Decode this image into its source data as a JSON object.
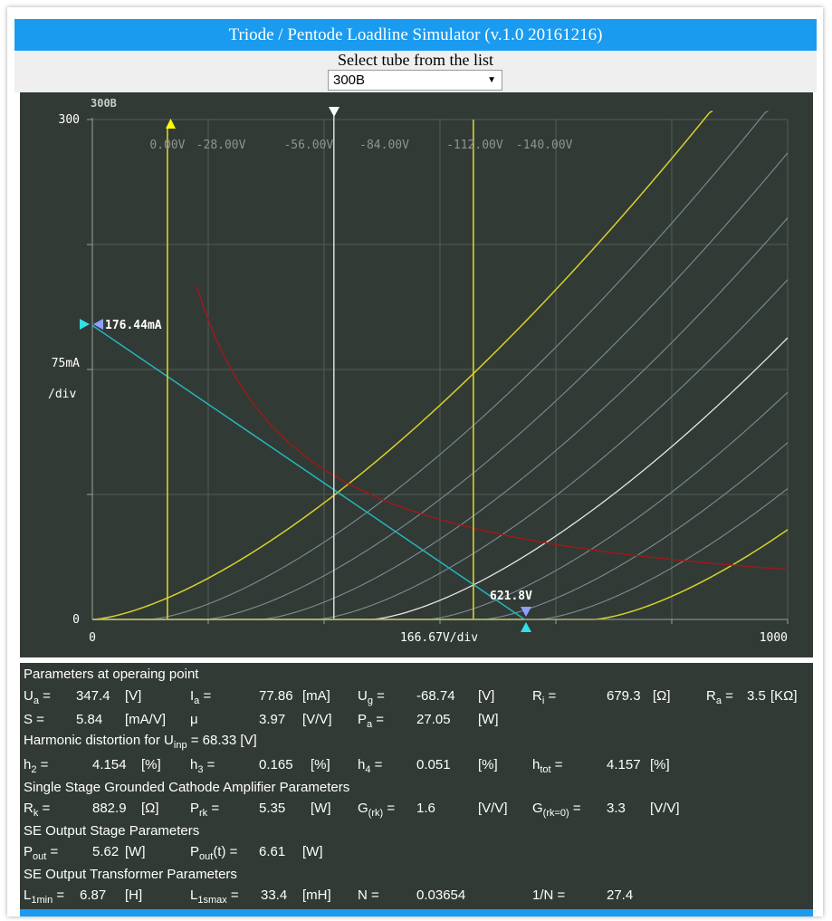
{
  "app": {
    "title": "Triode / Pentode Loadline Simulator (v.1.0 20161216)",
    "select_label": "Select tube from the list",
    "selected_tube": "300B"
  },
  "chart_data": {
    "type": "line",
    "tube": "300B",
    "x_axis": {
      "min": 0,
      "max": 1000,
      "label_min": "0",
      "label_mid": "166.67V/div",
      "label_max": "1000"
    },
    "y_axis": {
      "min": 0,
      "max": 300,
      "label_top": "300",
      "label_mid": "75mA",
      "label_unit": "/div",
      "label_min": "0"
    },
    "grid": true,
    "grid_labels": [
      "0.00V",
      "-28.00V",
      "-56.00V",
      "-84.00V",
      "-112.00V",
      "-140.00V"
    ],
    "operating_point": {
      "ua": 347.4,
      "ia": 77.86
    },
    "load_line": {
      "i_max_label": "176.44mA",
      "i_max": 176.44,
      "u_max_label": "621.8V",
      "u_max": 621.8
    },
    "max_dissipation_curve": true,
    "colors": {
      "background": "#323a35",
      "grid": "#525c55",
      "curves": "#7c8d96",
      "active": "#d6d22b",
      "operating": "#e6e6e6",
      "loadline": "#21b8c0",
      "dissipation": "#a01818"
    }
  },
  "params": {
    "h_op": "Parameters at operaing point",
    "ua_l": "U",
    "ua_s": "a",
    "ua_eq": " =",
    "ua_v": "347.4",
    "ua_u": "[V]",
    "ia_l": "I",
    "ia_s": "a",
    "ia_eq": " =",
    "ia_v": "77.86",
    "ia_u": "[mA]",
    "ug_l": "U",
    "ug_s": "g",
    "ug_eq": " =",
    "ug_v": "-68.74",
    "ug_u": "[V]",
    "ri_l": "R",
    "ri_s": "i",
    "ri_eq": " =",
    "ri_v": "679.3",
    "ri_u": "[Ω]",
    "ra_l": "R",
    "ra_s": "a",
    "ra_eq": " =",
    "ra_v": "3.5",
    "ra_u": "[KΩ]",
    "s_l": "S =",
    "s_v": "5.84",
    "s_u": "[mA/V]",
    "mu_l": "μ",
    "mu_v": "3.97",
    "mu_u": "[V/V]",
    "pa_l": "P",
    "pa_s": "a",
    "pa_eq": " =",
    "pa_v": "27.05",
    "pa_u": "[W]",
    "h_hd_pre": "Harmonic distortion for U",
    "h_hd_sub": "inp",
    "h_hd_post": " = 68.33 [V]",
    "h2_l": "h",
    "h2_s": "2",
    "h2_eq": " =",
    "h2_v": "4.154",
    "h2_u": "[%]",
    "h3_l": "h",
    "h3_s": "3",
    "h3_eq": " =",
    "h3_v": "0.165",
    "h3_u": "[%]",
    "h4_l": "h",
    "h4_s": "4",
    "h4_eq": " =",
    "h4_v": "0.051",
    "h4_u": "[%]",
    "ht_l": "h",
    "ht_s": "tot",
    "ht_eq": " =",
    "ht_v": "4.157",
    "ht_u": "[%]",
    "h_sscg": "Single Stage Grounded Cathode Amplifier Parameters",
    "rk_l": "R",
    "rk_s": "k",
    "rk_eq": " =",
    "rk_v": "882.9",
    "rk_u": "[Ω]",
    "prk_l": "P",
    "prk_s": "rk",
    "prk_eq": " =",
    "prk_v": "5.35",
    "prk_u": "[W]",
    "grk_l": "G",
    "grk_s": "(rk)",
    "grk_eq": " =",
    "grk_v": "1.6",
    "grk_u": "[V/V]",
    "grk0_l": "G",
    "grk0_s": "(rk=0)",
    "grk0_eq": " =",
    "grk0_v": "3.3",
    "grk0_u": "[V/V]",
    "h_seo": "SE Output Stage Parameters",
    "pout_l": "P",
    "pout_s": "out",
    "pout_eq": " =",
    "pout_v": "5.62",
    "pout_u": "[W]",
    "poutt_l": "P",
    "poutt_s": "out",
    "poutt_post": "(t) =",
    "poutt_v": "6.61",
    "poutt_u": "[W]",
    "h_set": "SE Output Transformer Parameters",
    "l1_l": "L",
    "l1_s": "1min",
    "l1_eq": " =",
    "l1_v": "6.87",
    "l1_u": "[H]",
    "l1s_l": "L",
    "l1s_s": "1smax",
    "l1s_eq": " =",
    "l1s_v": "33.4",
    "l1s_u": "[mH]",
    "n_l": "N =",
    "n_v": "0.03654",
    "inv_l": "1/N =",
    "inv_v": "27.4"
  }
}
